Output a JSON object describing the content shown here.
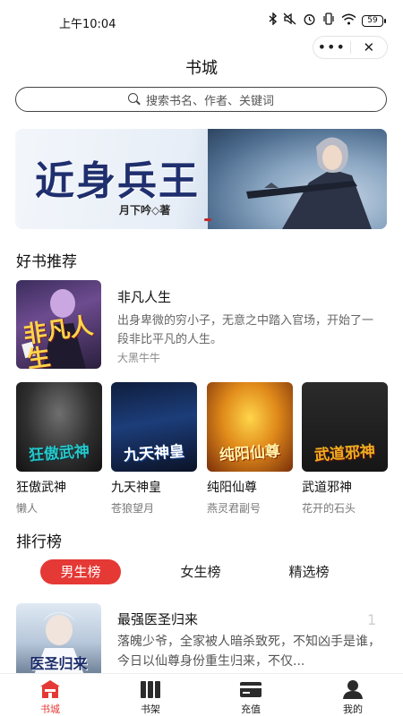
{
  "status_bar": {
    "time": "上午10:04",
    "battery": "59"
  },
  "capsule": {
    "more": "•••",
    "close": "✕"
  },
  "page": {
    "title": "书城"
  },
  "search": {
    "placeholder": "搜索书名、作者、关键词"
  },
  "banner": {
    "title": "近身兵王",
    "author": "月下吟◇著"
  },
  "recommend": {
    "title": "好书推荐",
    "featured": {
      "title": "非凡人生",
      "description": "出身卑微的穷小子，无意之中踏入官场，开始了一段非比平凡的人生。",
      "author": "大黑牛牛",
      "cover_text": "非凡人生"
    },
    "books": [
      {
        "title": "狂傲武神",
        "author": "懒人",
        "cover_text": "狂傲武神"
      },
      {
        "title": "九天神皇",
        "author": "苍狼望月",
        "cover_text": "九天神皇"
      },
      {
        "title": "纯阳仙尊",
        "author": "燕灵君副号",
        "cover_text": "纯阳仙尊"
      },
      {
        "title": "武道邪神",
        "author": "花开的石头",
        "cover_text": "武道邪神"
      }
    ]
  },
  "ranking": {
    "title": "排行榜",
    "tabs": [
      "男生榜",
      "女生榜",
      "精选榜"
    ],
    "active_tab": "男生榜",
    "items": [
      {
        "rank": "1",
        "title": "最强医圣归来",
        "description": "落魄少爷，全家被人暗杀致死，不知凶手是谁，今日以仙尊身份重生归来，不仅...",
        "cover_text": "医圣归来"
      }
    ]
  },
  "tabbar": {
    "items": [
      {
        "label": "书城",
        "icon": "bookstore-icon",
        "active": true
      },
      {
        "label": "书架",
        "icon": "bookshelf-icon",
        "active": false
      },
      {
        "label": "充值",
        "icon": "recharge-card-icon",
        "active": false
      },
      {
        "label": "我的",
        "icon": "user-icon",
        "active": false
      }
    ]
  },
  "colors": {
    "accent": "#e53935",
    "text": "#111111",
    "muted": "#666666"
  }
}
